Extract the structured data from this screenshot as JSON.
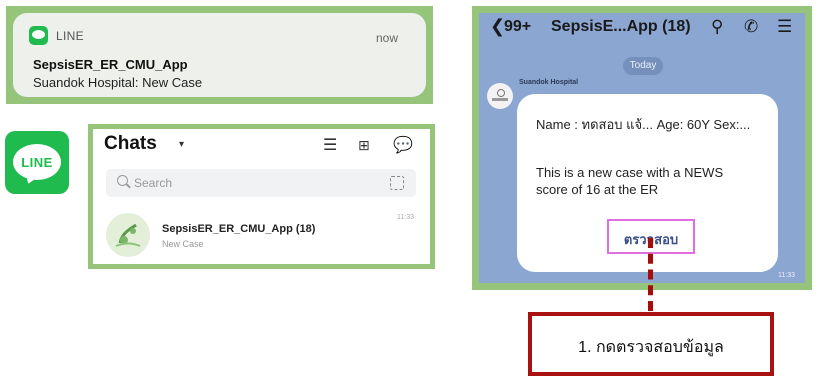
{
  "notification": {
    "app_name": "LINE",
    "time": "now",
    "title": "SepsisER_ER_CMU_App",
    "body": "Suandok Hospital: New Case"
  },
  "app_icon": {
    "label": "LINE"
  },
  "chats": {
    "title": "Chats",
    "search_placeholder": "Search",
    "item": {
      "name": "SepsisER_ER_CMU_App (18)",
      "preview": "New Case",
      "time": "11:33"
    }
  },
  "chat_window": {
    "back_count": "99+",
    "title": "SepsisE...App (18)",
    "date_chip": "Today",
    "sender": "Suandok Hospital",
    "message_line1": "Name : ทดสอบ แจ้... Age: 60Y Sex:...",
    "message_line2": "This is a new case with a NEWS",
    "message_line3": "score of 16 at the ER",
    "action_button": "ตรวจสอบ",
    "time": "11:33"
  },
  "annotation": {
    "text": "1. กดตรวจสอบข้อมูล"
  },
  "colors": {
    "panel_border": "#95c47a",
    "line_green": "#1fbb4f",
    "chat_bg": "#8aa6d1",
    "annotation_red": "#aa1212",
    "button_outline": "#e06ee0"
  }
}
